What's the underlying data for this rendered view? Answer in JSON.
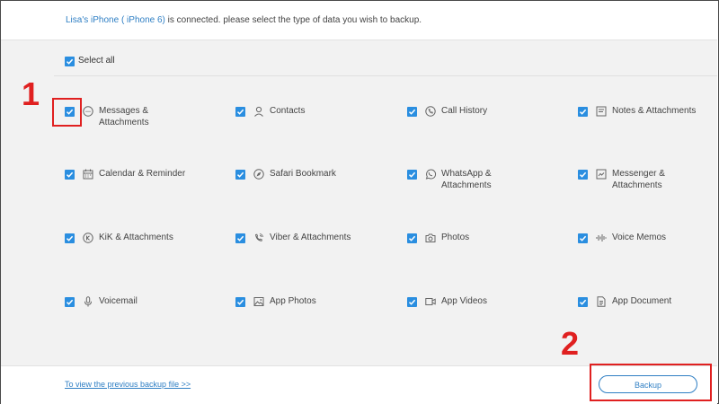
{
  "header": {
    "device_name": "Lisa's iPhone ( iPhone 6)",
    "message": " is connected. please select the type of data you wish to backup."
  },
  "select_all": {
    "label": "Select all",
    "checked": true
  },
  "items": [
    {
      "label": "Messages & Attachments",
      "icon": "message-icon",
      "checked": true
    },
    {
      "label": "Contacts",
      "icon": "person-icon",
      "checked": true
    },
    {
      "label": "Call History",
      "icon": "phone-icon",
      "checked": true
    },
    {
      "label": "Notes & Attachments",
      "icon": "note-icon",
      "checked": true
    },
    {
      "label": "Calendar & Reminder",
      "icon": "calendar-icon",
      "checked": true
    },
    {
      "label": "Safari Bookmark",
      "icon": "compass-icon",
      "checked": true
    },
    {
      "label": "WhatsApp & Attachments",
      "icon": "whatsapp-icon",
      "checked": true
    },
    {
      "label": "Messenger & Attachments",
      "icon": "messenger-icon",
      "checked": true
    },
    {
      "label": "KiK & Attachments",
      "icon": "kik-icon",
      "checked": true
    },
    {
      "label": "Viber & Attachments",
      "icon": "viber-icon",
      "checked": true
    },
    {
      "label": "Photos",
      "icon": "camera-icon",
      "checked": true
    },
    {
      "label": "Voice Memos",
      "icon": "waveform-icon",
      "checked": true
    },
    {
      "label": "Voicemail",
      "icon": "microphone-icon",
      "checked": true
    },
    {
      "label": "App Photos",
      "icon": "image-icon",
      "checked": true
    },
    {
      "label": "App Videos",
      "icon": "video-icon",
      "checked": true
    },
    {
      "label": "App Document",
      "icon": "document-icon",
      "checked": true
    }
  ],
  "footer": {
    "previous_backup_link": "To view the previous backup file >>",
    "backup_button": "Backup"
  },
  "annotations": {
    "step1": "1",
    "step2": "2"
  },
  "colors": {
    "accent": "#2a8ee0",
    "link": "#2f7fc4",
    "annotation": "#e02020",
    "panel": "#f2f2f2"
  }
}
